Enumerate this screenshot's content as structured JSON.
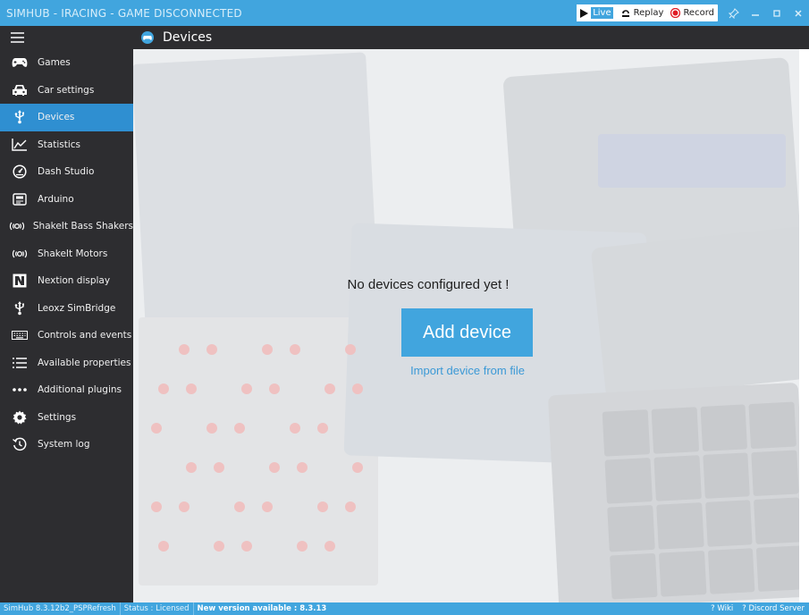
{
  "window": {
    "title": "SIMHUB - IRACING - GAME DISCONNECTED",
    "modes": [
      {
        "label": "Live",
        "icon": "play-icon"
      },
      {
        "label": "Replay",
        "icon": "replay-icon"
      },
      {
        "label": "Record",
        "icon": "record-icon"
      }
    ],
    "accent_color": "#41a5de"
  },
  "sidebar": {
    "items": [
      {
        "label": "Games",
        "icon": "gamepad-icon"
      },
      {
        "label": "Car settings",
        "icon": "car-icon"
      },
      {
        "label": "Devices",
        "icon": "usb-icon",
        "active": true
      },
      {
        "label": "Statistics",
        "icon": "chart-line-icon"
      },
      {
        "label": "Dash Studio",
        "icon": "gauge-icon"
      },
      {
        "label": "Arduino",
        "icon": "arduino-icon"
      },
      {
        "label": "ShakeIt Bass Shakers",
        "icon": "vibration-icon"
      },
      {
        "label": "ShakeIt Motors",
        "icon": "vibration-icon"
      },
      {
        "label": "Nextion display",
        "icon": "nextion-icon"
      },
      {
        "label": "Leoxz SimBridge",
        "icon": "usb-icon"
      },
      {
        "label": "Controls and events",
        "icon": "keyboard-icon"
      },
      {
        "label": "Available properties",
        "icon": "list-icon"
      },
      {
        "label": "Additional plugins",
        "icon": "dots-icon"
      },
      {
        "label": "Settings",
        "icon": "gear-icon"
      },
      {
        "label": "System log",
        "icon": "history-icon"
      }
    ]
  },
  "header": {
    "title": "Devices"
  },
  "main": {
    "empty_message": "No devices configured yet !",
    "add_device_label": "Add device",
    "import_label": "Import device from file"
  },
  "statusbar": {
    "version": "SimHub 8.3.12b2_PSPRefresh",
    "status": "Status : Licensed",
    "update": "New version available : 8.3.13",
    "wiki": "? Wiki",
    "discord": "? Discord Server"
  }
}
